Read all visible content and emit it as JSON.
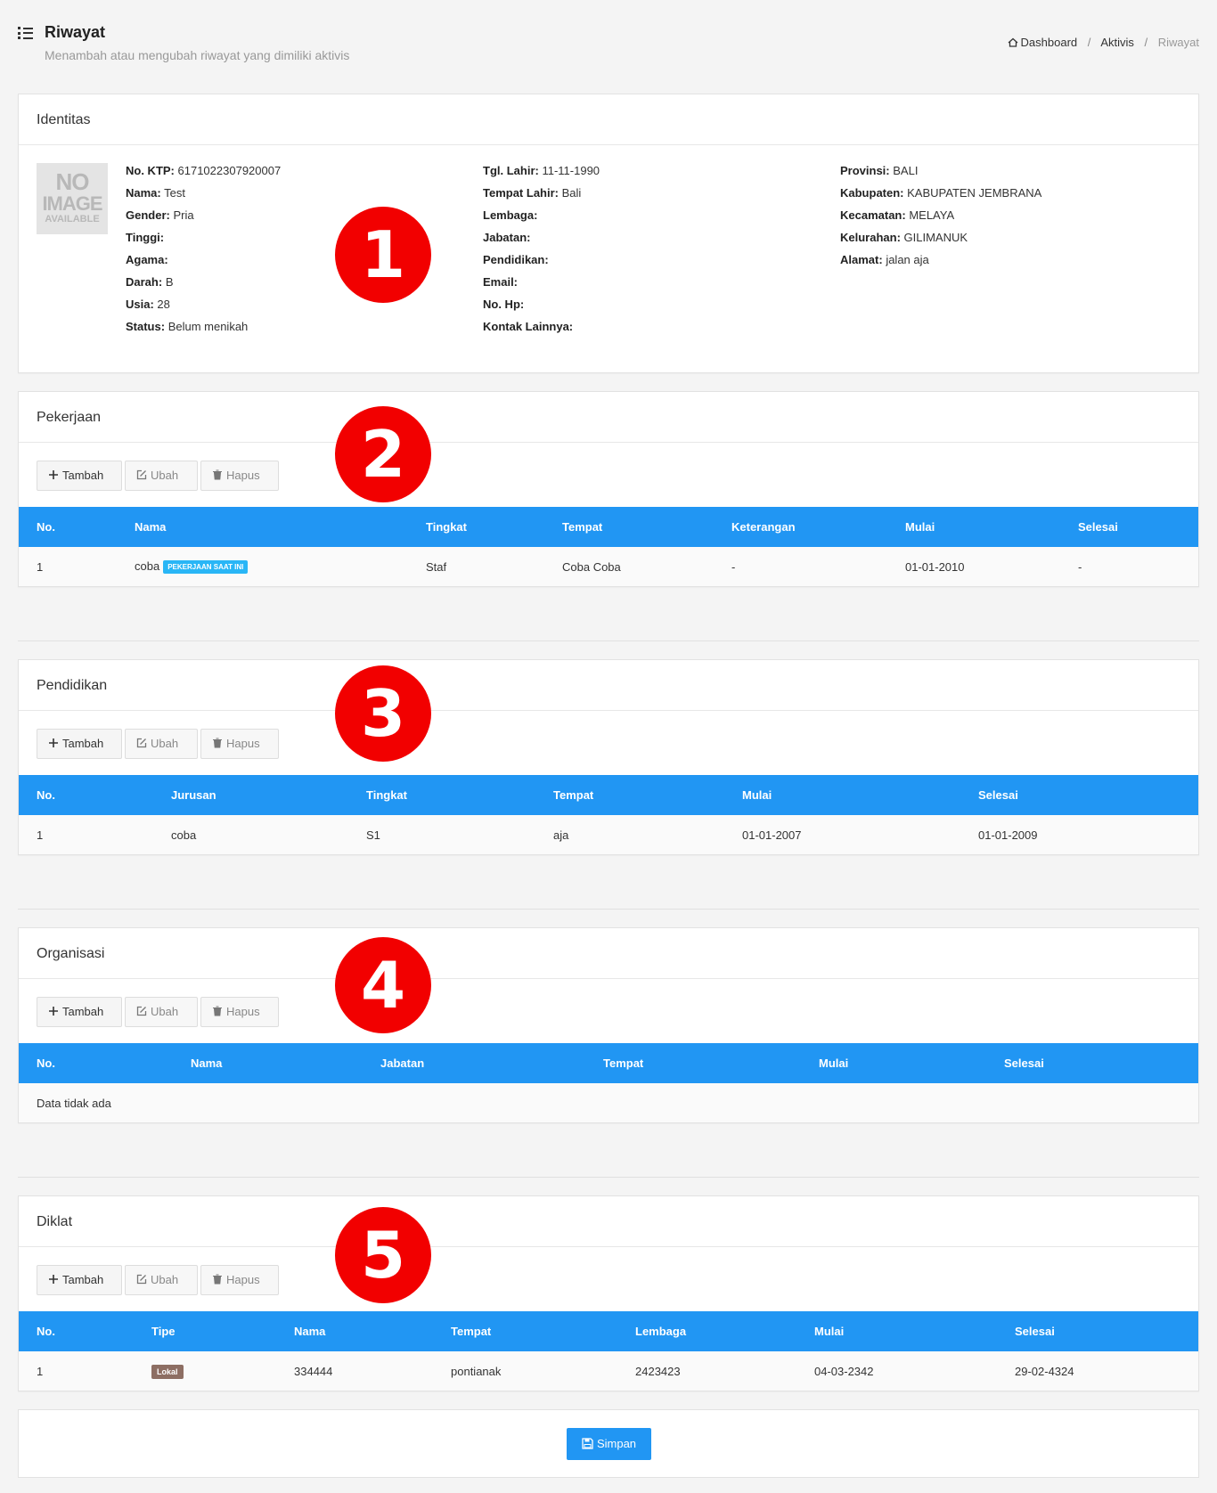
{
  "header": {
    "title": "Riwayat",
    "subtitle": "Menambah atau mengubah riwayat yang dimiliki aktivis",
    "breadcrumb": [
      "Dashboard",
      "Aktivis",
      "Riwayat"
    ]
  },
  "identitas": {
    "title": "Identitas",
    "no_image": [
      "NO",
      "IMAGE",
      "AVAILABLE"
    ],
    "col1": [
      {
        "label": "No. KTP:",
        "value": "6171022307920007"
      },
      {
        "label": "Nama:",
        "value": "Test"
      },
      {
        "label": "Gender:",
        "value": "Pria"
      },
      {
        "label": "Tinggi:",
        "value": ""
      },
      {
        "label": "Agama:",
        "value": ""
      },
      {
        "label": "Darah:",
        "value": "B"
      },
      {
        "label": "Usia:",
        "value": "28"
      },
      {
        "label": "Status:",
        "value": "Belum menikah"
      }
    ],
    "col2": [
      {
        "label": "Tgl. Lahir:",
        "value": "11-11-1990"
      },
      {
        "label": "Tempat Lahir:",
        "value": "Bali"
      },
      {
        "label": "Lembaga:",
        "value": ""
      },
      {
        "label": "Jabatan:",
        "value": ""
      },
      {
        "label": "Pendidikan:",
        "value": ""
      },
      {
        "label": "Email:",
        "value": ""
      },
      {
        "label": "No. Hp:",
        "value": ""
      },
      {
        "label": "Kontak Lainnya:",
        "value": ""
      }
    ],
    "col3": [
      {
        "label": "Provinsi:",
        "value": "BALI"
      },
      {
        "label": "Kabupaten:",
        "value": "KABUPATEN JEMBRANA"
      },
      {
        "label": "Kecamatan:",
        "value": "MELAYA"
      },
      {
        "label": "Kelurahan:",
        "value": "GILIMANUK"
      },
      {
        "label": "Alamat:",
        "value": "jalan aja"
      }
    ]
  },
  "buttons": {
    "add": "Tambah",
    "edit": "Ubah",
    "delete": "Hapus",
    "save": "Simpan"
  },
  "pekerjaan": {
    "title": "Pekerjaan",
    "columns": [
      "No.",
      "Nama",
      "Tingkat",
      "Tempat",
      "Keterangan",
      "Mulai",
      "Selesai"
    ],
    "rows": [
      {
        "no": "1",
        "nama": "coba",
        "badge": "PEKERJAAN SAAT INI",
        "tingkat": "Staf",
        "tempat": "Coba Coba",
        "keterangan": "-",
        "mulai": "01-01-2010",
        "selesai": "-"
      }
    ]
  },
  "pendidikan": {
    "title": "Pendidikan",
    "columns": [
      "No.",
      "Jurusan",
      "Tingkat",
      "Tempat",
      "Mulai",
      "Selesai"
    ],
    "rows": [
      {
        "no": "1",
        "jurusan": "coba",
        "tingkat": "S1",
        "tempat": "aja",
        "mulai": "01-01-2007",
        "selesai": "01-01-2009"
      }
    ]
  },
  "organisasi": {
    "title": "Organisasi",
    "columns": [
      "No.",
      "Nama",
      "Jabatan",
      "Tempat",
      "Mulai",
      "Selesai"
    ],
    "empty": "Data tidak ada"
  },
  "diklat": {
    "title": "Diklat",
    "columns": [
      "No.",
      "Tipe",
      "Nama",
      "Tempat",
      "Lembaga",
      "Mulai",
      "Selesai"
    ],
    "rows": [
      {
        "no": "1",
        "tipe": "Lokal",
        "nama": "334444",
        "tempat": "pontianak",
        "lembaga": "2423423",
        "mulai": "04-03-2342",
        "selesai": "29-02-4324"
      }
    ]
  },
  "markers": [
    "1",
    "2",
    "3",
    "4",
    "5"
  ],
  "colors": {
    "primary": "#2196f3",
    "marker": "#f20000",
    "badge_current": "#29b6f6",
    "badge_lokal": "#8d6e63"
  }
}
